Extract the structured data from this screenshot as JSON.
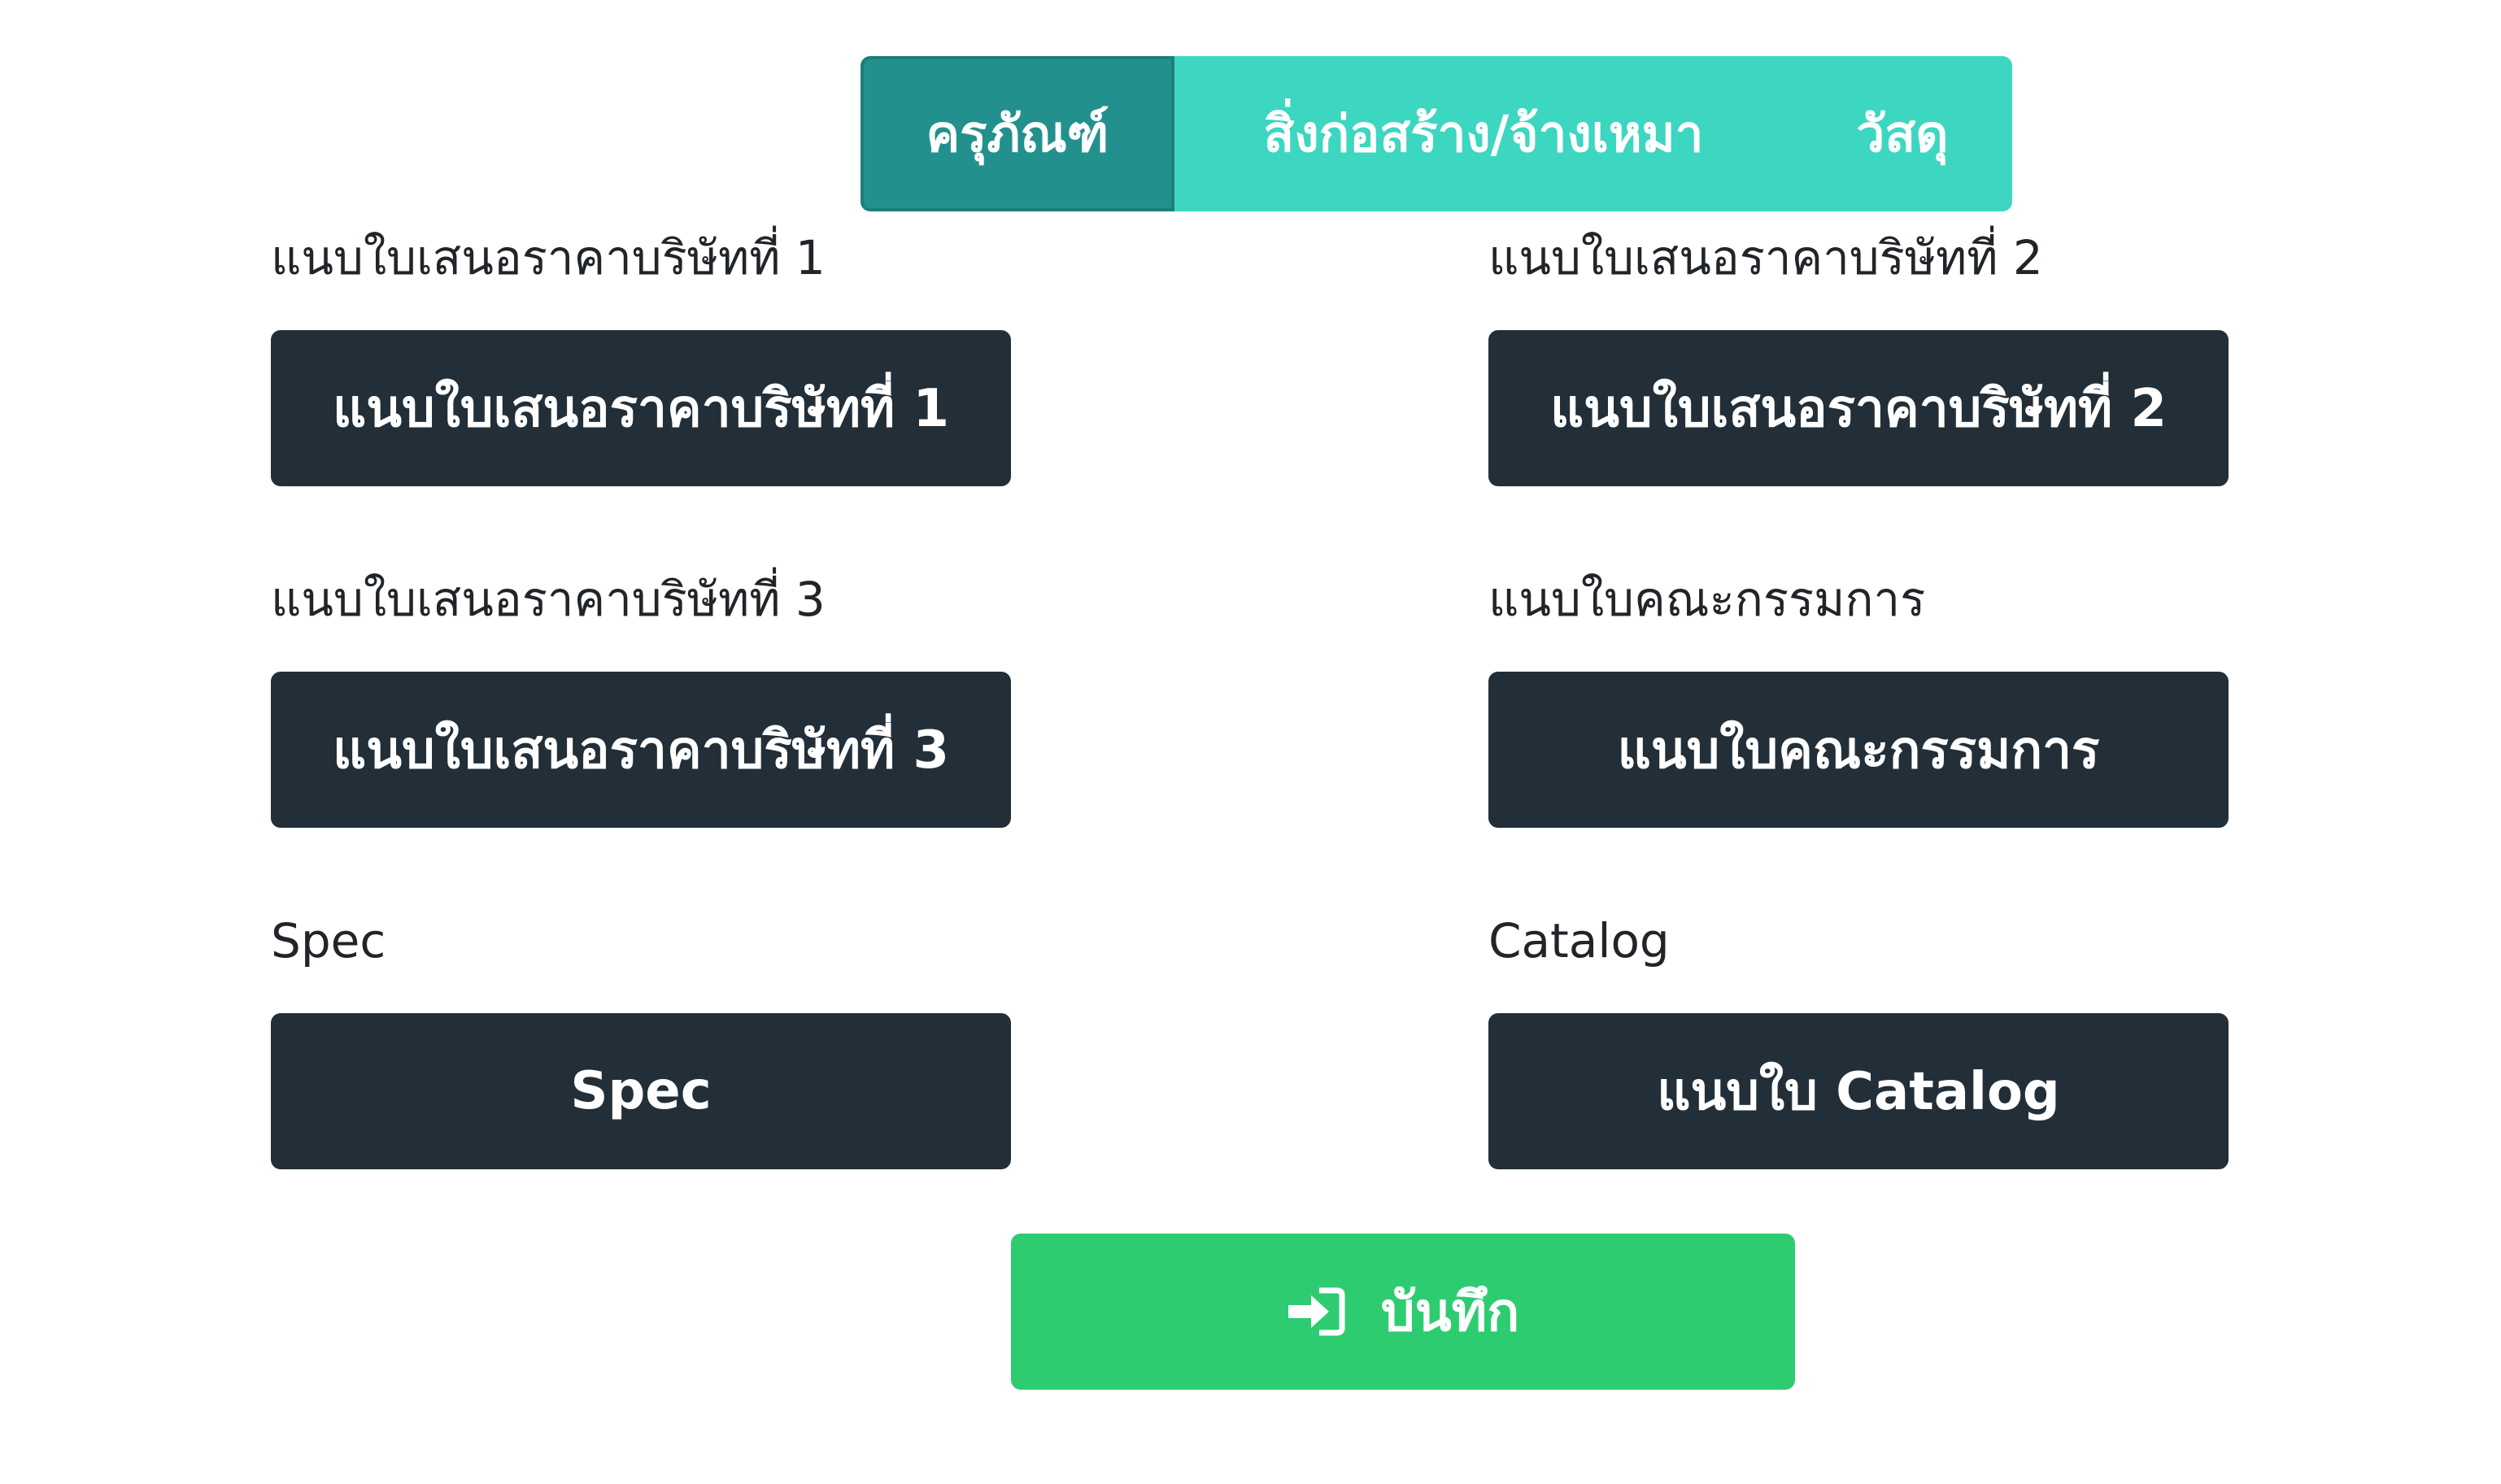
{
  "tabs": [
    {
      "label": "ครุภัณฑ์",
      "active": true
    },
    {
      "label": "สิ่งก่อสร้าง/จ้างเหมา",
      "active": false
    },
    {
      "label": "วัสดุ",
      "active": false
    }
  ],
  "fields": {
    "quote1": {
      "label": "แนบใบเสนอราคาบริษัทที่ 1",
      "button": "แนบใบเสนอราคาบริษัทที่ 1"
    },
    "quote2": {
      "label": "แนบใบเสนอราคาบริษัทที่ 2",
      "button": "แนบใบเสนอราคาบริษัทที่ 2"
    },
    "quote3": {
      "label": "แนบใบเสนอราคาบริษัทที่ 3",
      "button": "แนบใบเสนอราคาบริษัทที่ 3"
    },
    "committee": {
      "label": "แนบใบคณะกรรมการ",
      "button": "แนบใบคณะกรรมการ"
    },
    "spec": {
      "label": "Spec",
      "button": "Spec"
    },
    "catalog": {
      "label": "Catalog",
      "button": "แนบใบ Catalog"
    }
  },
  "save": {
    "label": "บันทึก",
    "icon": "sign-in-icon"
  },
  "colors": {
    "tab_bg": "#3dd6c1",
    "tab_active": "#22918d",
    "button_dark": "#232f38",
    "save_green": "#2ecc71"
  }
}
